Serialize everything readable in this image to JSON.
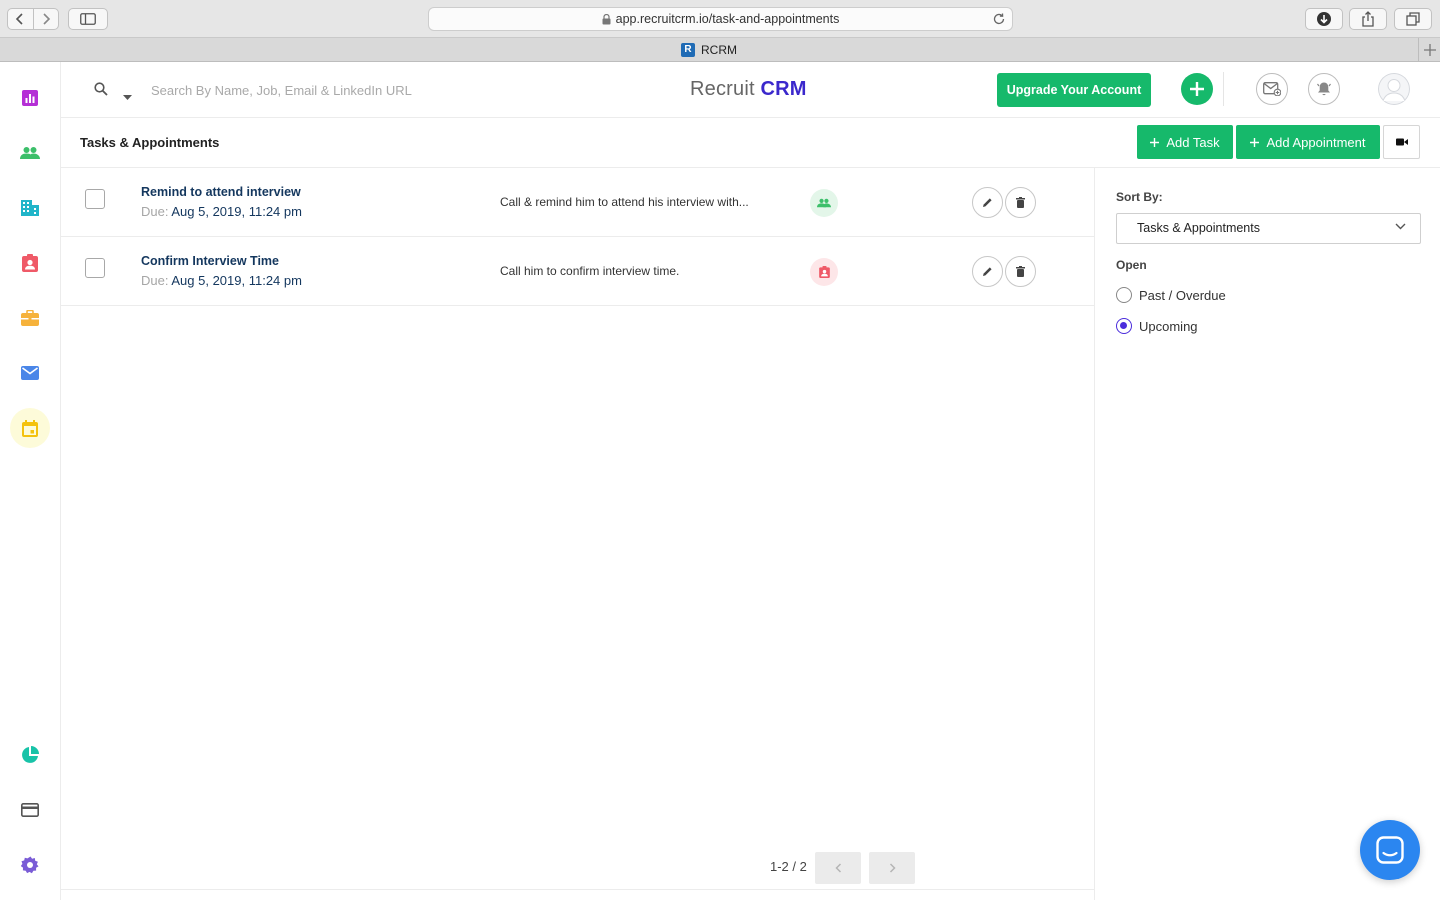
{
  "browser": {
    "url": "app.recruitcrm.io/task-and-appointments",
    "tab_title": "RCRM",
    "tab_favicon_letter": "R"
  },
  "header": {
    "search_placeholder": "Search By Name, Job, Email & LinkedIn URL",
    "brand_part1": "Recruit",
    "brand_part2": "CRM",
    "upgrade_label": "Upgrade Your Account"
  },
  "sidebar": {
    "items": [
      {
        "name": "dashboard-icon",
        "color": "#b52fd6"
      },
      {
        "name": "candidates-icon",
        "color": "#3cbf6a"
      },
      {
        "name": "companies-icon",
        "color": "#21b5c9"
      },
      {
        "name": "contacts-icon",
        "color": "#ef5a68"
      },
      {
        "name": "jobs-icon",
        "color": "#f6b23b"
      },
      {
        "name": "email-icon",
        "color": "#4a86e8"
      },
      {
        "name": "calendar-icon",
        "color": "#f4c20d",
        "active": true
      },
      {
        "name": "reports-icon",
        "color": "#18c3a8"
      },
      {
        "name": "billing-icon",
        "color": "#555555"
      },
      {
        "name": "settings-icon",
        "color": "#7a5cd6"
      }
    ]
  },
  "page": {
    "title": "Tasks & Appointments",
    "add_task_label": "Add Task",
    "add_appointment_label": "Add Appointment"
  },
  "tasks": [
    {
      "title": "Remind to attend interview",
      "due_label": "Due:",
      "due_value": "Aug 5, 2019, 11:24 pm",
      "description": "Call & remind him to attend his interview with...",
      "related_type": "candidate"
    },
    {
      "title": "Confirm Interview Time",
      "due_label": "Due:",
      "due_value": "Aug 5, 2019, 11:24 pm",
      "description": "Call him to confirm interview time.",
      "related_type": "contact"
    }
  ],
  "pagination": {
    "text": "1-2 / 2"
  },
  "filters": {
    "sort_label": "Sort By:",
    "sort_value": "Tasks & Appointments",
    "open_label": "Open",
    "options": [
      {
        "label": "Past / Overdue",
        "selected": false
      },
      {
        "label": "Upcoming",
        "selected": true
      }
    ]
  },
  "colors": {
    "accent_green": "#16b96b",
    "brand_blue": "#3b28cc",
    "link_navy": "#14375e",
    "radio_purple": "#4b2ddc",
    "chat_blue": "#2b86f0"
  }
}
